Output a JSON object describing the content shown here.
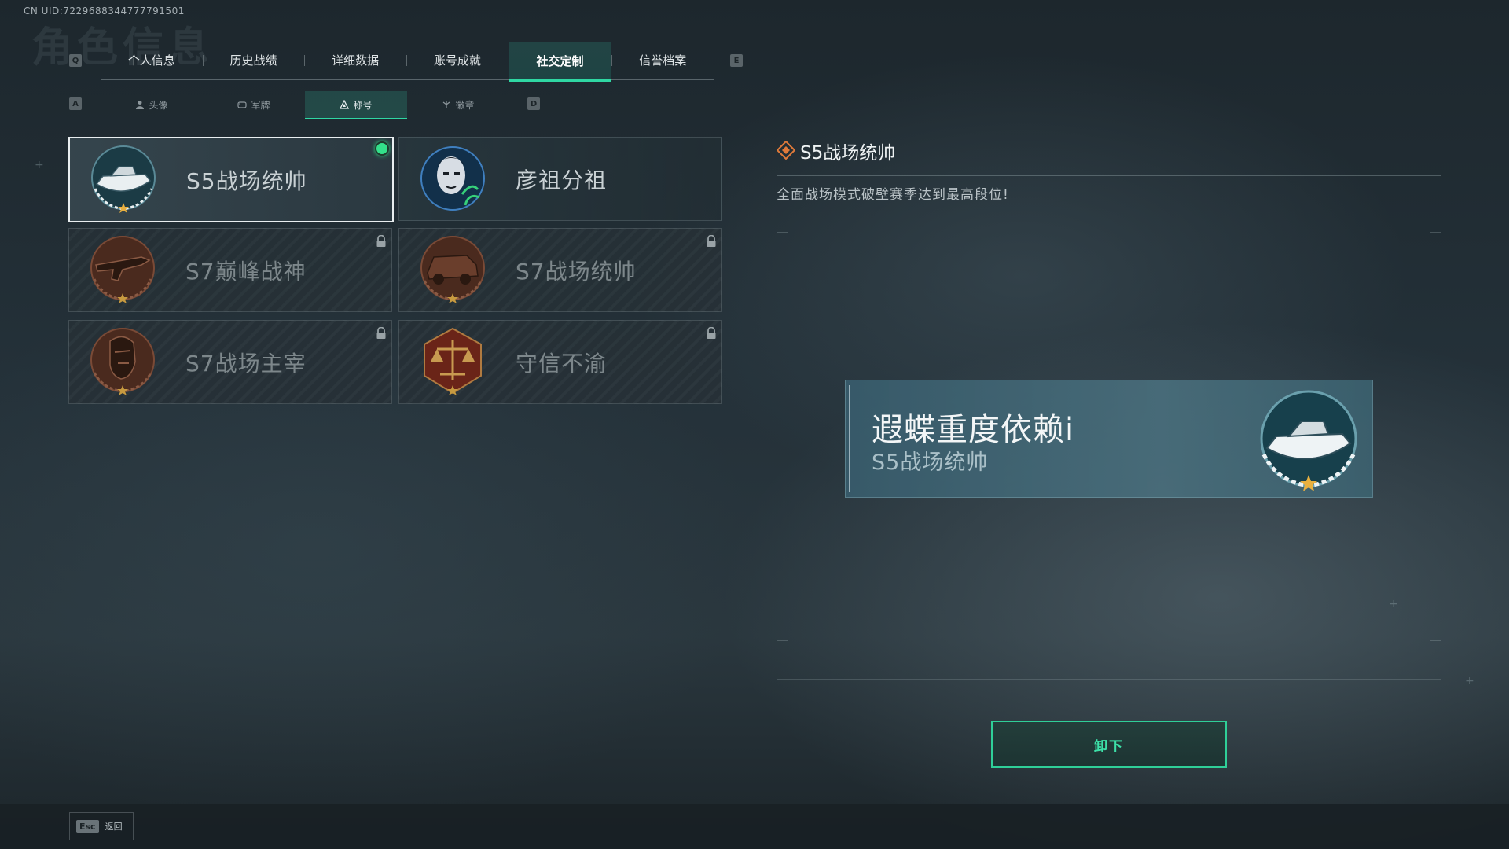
{
  "uid_text": "CN UID:7229688344777791501",
  "bg_title": "角色信息",
  "keys": {
    "prev_tab": "Q",
    "next_tab": "E",
    "prev_sub": "A",
    "next_sub": "D"
  },
  "main_tabs": [
    {
      "label": "个人信息",
      "active": false
    },
    {
      "label": "历史战绩",
      "active": false
    },
    {
      "label": "详细数据",
      "active": false
    },
    {
      "label": "账号成就",
      "active": false
    },
    {
      "label": "社交定制",
      "active": true
    },
    {
      "label": "信誉档案",
      "active": false
    }
  ],
  "sub_tabs": [
    {
      "label": "头像",
      "icon": "person-icon",
      "active": false
    },
    {
      "label": "军牌",
      "icon": "dog-tag-icon",
      "active": false
    },
    {
      "label": "称号",
      "icon": "title-icon",
      "active": true
    },
    {
      "label": "徽章",
      "icon": "badge-icon",
      "active": false
    }
  ],
  "titles": [
    {
      "label": "S5战场统帅",
      "emblem": "speedboat-emblem-icon",
      "selected": true,
      "equipped": true,
      "locked": false
    },
    {
      "label": "彦祖分祖",
      "emblem": "portrait-emblem-icon",
      "selected": false,
      "equipped": false,
      "locked": false
    },
    {
      "label": "S7巅峰战神",
      "emblem": "rifle-emblem-icon",
      "selected": false,
      "equipped": false,
      "locked": true
    },
    {
      "label": "S7战场统帅",
      "emblem": "armored-vehicle-emblem-icon",
      "selected": false,
      "equipped": false,
      "locked": true
    },
    {
      "label": "S7战场主宰",
      "emblem": "warrior-head-emblem-icon",
      "selected": false,
      "equipped": false,
      "locked": true
    },
    {
      "label": "守信不渝",
      "emblem": "scales-emblem-icon",
      "selected": false,
      "equipped": false,
      "locked": true
    }
  ],
  "detail": {
    "title": "S5战场统帅",
    "description": "全面战场模式破壁赛季达到最高段位!"
  },
  "name_card": {
    "player_name": "遐蝶重度依赖i",
    "title": "S5战场统帅",
    "emblem": "speedboat-emblem-icon"
  },
  "unequip_label": "卸下",
  "back": {
    "key": "Esc",
    "label": "返回"
  },
  "colors": {
    "accent": "#2fd7a3",
    "equipped_dot": "#33e08a",
    "star": "#e8b040"
  }
}
